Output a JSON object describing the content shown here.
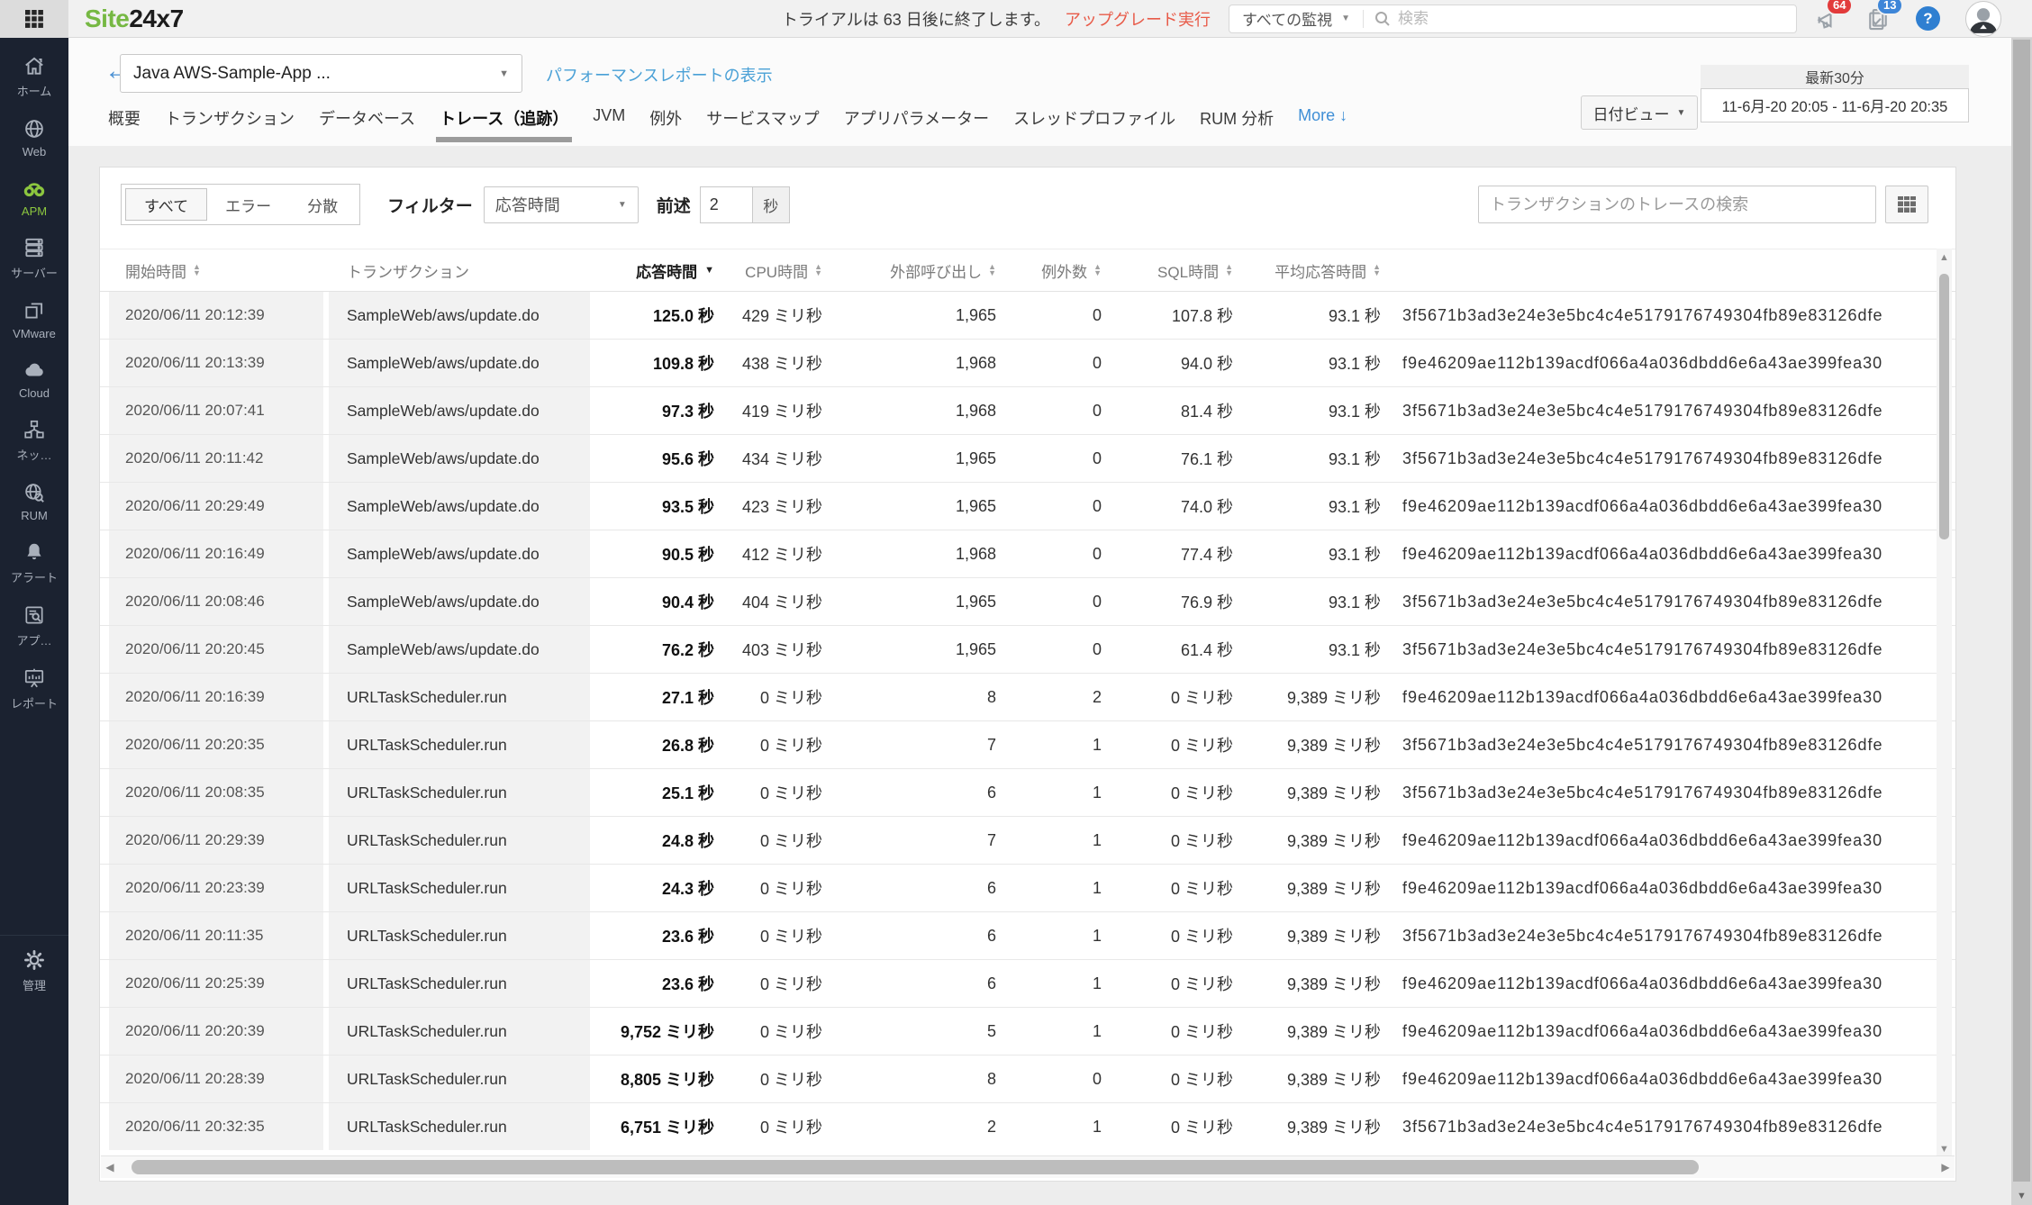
{
  "logo": {
    "part1": "Site",
    "part2": "24x7"
  },
  "topbar": {
    "trial_text": "トライアルは 63 日後に終了します。",
    "upgrade_label": "アップグレード実行",
    "monitor_filter_label": "すべての監視",
    "search_placeholder": "検索",
    "notifications_badge": "64",
    "tasks_badge": "13",
    "help_label": "?"
  },
  "sidebar": {
    "items": [
      {
        "label": "ホーム",
        "icon": "home"
      },
      {
        "label": "Web",
        "icon": "globe"
      },
      {
        "label": "APM",
        "icon": "binoculars",
        "active": true
      },
      {
        "label": "サーバー",
        "icon": "server"
      },
      {
        "label": "VMware",
        "icon": "vmware-squares"
      },
      {
        "label": "Cloud",
        "icon": "cloud"
      },
      {
        "label": "ネッ…",
        "icon": "network"
      },
      {
        "label": "RUM",
        "icon": "globe-magnifier"
      },
      {
        "label": "アラート",
        "icon": "bell"
      },
      {
        "label": "アプ…",
        "icon": "app-magnifier"
      },
      {
        "label": "レポート",
        "icon": "report-board"
      }
    ],
    "admin": {
      "label": "管理",
      "icon": "gear"
    }
  },
  "header": {
    "app_selector_value": "Java AWS-Sample-App ...",
    "performance_link_label": "パフォーマンスレポートの表示",
    "date_view_label": "日付ビュー",
    "time_range_label": "最新30分",
    "time_range_value": "11-6月-20 20:05 - 11-6月-20 20:35"
  },
  "tabs": {
    "items": [
      "概要",
      "トランザクション",
      "データベース",
      "トレース（追跡）",
      "JVM",
      "例外",
      "サービスマップ",
      "アプリパラメーター",
      "スレッドプロファイル",
      "RUM 分析",
      "More ↓"
    ],
    "active_index": 3
  },
  "filter_bar": {
    "view_options": [
      "すべて",
      "エラー",
      "分散"
    ],
    "selected_view_index": 0,
    "filter_label": "フィルター",
    "filter_field_value": "応答時間",
    "condition_label": "前述",
    "threshold_value": "2",
    "unit_label": "秒",
    "trace_search_placeholder": "トランザクションのトレースの検索"
  },
  "table": {
    "col_keys": [
      "start-time",
      "transaction",
      "response-time",
      "cpu-time",
      "external-calls",
      "exception-count",
      "sql-time",
      "avg-response-time",
      "trace-id"
    ],
    "columns": [
      {
        "label": "開始時間",
        "sort": "updown"
      },
      {
        "label": "トランザクション",
        "sort": "none"
      },
      {
        "label": "応答時間",
        "sort": "desc"
      },
      {
        "label": "CPU時間",
        "sort": "updown"
      },
      {
        "label": "外部呼び出し",
        "sort": "updown"
      },
      {
        "label": "例外数",
        "sort": "updown"
      },
      {
        "label": "SQL時間",
        "sort": "updown"
      },
      {
        "label": "平均応答時間",
        "sort": "updown"
      },
      {
        "label": "",
        "sort": "none"
      }
    ],
    "rows": [
      [
        "2020/06/11 20:12:39",
        "SampleWeb/aws/update.do",
        "125.0 秒",
        "429 ミリ秒",
        "1,965",
        "0",
        "107.8 秒",
        "93.1 秒",
        "3f5671b3ad3e24e3e5bc4c4e5179176749304fb89e83126dfe"
      ],
      [
        "2020/06/11 20:13:39",
        "SampleWeb/aws/update.do",
        "109.8 秒",
        "438 ミリ秒",
        "1,968",
        "0",
        "94.0 秒",
        "93.1 秒",
        "f9e46209ae112b139acdf066a4a036dbdd6e6a43ae399fea30"
      ],
      [
        "2020/06/11 20:07:41",
        "SampleWeb/aws/update.do",
        "97.3 秒",
        "419 ミリ秒",
        "1,968",
        "0",
        "81.4 秒",
        "93.1 秒",
        "3f5671b3ad3e24e3e5bc4c4e5179176749304fb89e83126dfe"
      ],
      [
        "2020/06/11 20:11:42",
        "SampleWeb/aws/update.do",
        "95.6 秒",
        "434 ミリ秒",
        "1,965",
        "0",
        "76.1 秒",
        "93.1 秒",
        "3f5671b3ad3e24e3e5bc4c4e5179176749304fb89e83126dfe"
      ],
      [
        "2020/06/11 20:29:49",
        "SampleWeb/aws/update.do",
        "93.5 秒",
        "423 ミリ秒",
        "1,965",
        "0",
        "74.0 秒",
        "93.1 秒",
        "f9e46209ae112b139acdf066a4a036dbdd6e6a43ae399fea30"
      ],
      [
        "2020/06/11 20:16:49",
        "SampleWeb/aws/update.do",
        "90.5 秒",
        "412 ミリ秒",
        "1,968",
        "0",
        "77.4 秒",
        "93.1 秒",
        "f9e46209ae112b139acdf066a4a036dbdd6e6a43ae399fea30"
      ],
      [
        "2020/06/11 20:08:46",
        "SampleWeb/aws/update.do",
        "90.4 秒",
        "404 ミリ秒",
        "1,965",
        "0",
        "76.9 秒",
        "93.1 秒",
        "3f5671b3ad3e24e3e5bc4c4e5179176749304fb89e83126dfe"
      ],
      [
        "2020/06/11 20:20:45",
        "SampleWeb/aws/update.do",
        "76.2 秒",
        "403 ミリ秒",
        "1,965",
        "0",
        "61.4 秒",
        "93.1 秒",
        "3f5671b3ad3e24e3e5bc4c4e5179176749304fb89e83126dfe"
      ],
      [
        "2020/06/11 20:16:39",
        "URLTaskScheduler.run",
        "27.1 秒",
        "0 ミリ秒",
        "8",
        "2",
        "0 ミリ秒",
        "9,389 ミリ秒",
        "f9e46209ae112b139acdf066a4a036dbdd6e6a43ae399fea30"
      ],
      [
        "2020/06/11 20:20:35",
        "URLTaskScheduler.run",
        "26.8 秒",
        "0 ミリ秒",
        "7",
        "1",
        "0 ミリ秒",
        "9,389 ミリ秒",
        "3f5671b3ad3e24e3e5bc4c4e5179176749304fb89e83126dfe"
      ],
      [
        "2020/06/11 20:08:35",
        "URLTaskScheduler.run",
        "25.1 秒",
        "0 ミリ秒",
        "6",
        "1",
        "0 ミリ秒",
        "9,389 ミリ秒",
        "3f5671b3ad3e24e3e5bc4c4e5179176749304fb89e83126dfe"
      ],
      [
        "2020/06/11 20:29:39",
        "URLTaskScheduler.run",
        "24.8 秒",
        "0 ミリ秒",
        "7",
        "1",
        "0 ミリ秒",
        "9,389 ミリ秒",
        "f9e46209ae112b139acdf066a4a036dbdd6e6a43ae399fea30"
      ],
      [
        "2020/06/11 20:23:39",
        "URLTaskScheduler.run",
        "24.3 秒",
        "0 ミリ秒",
        "6",
        "1",
        "0 ミリ秒",
        "9,389 ミリ秒",
        "f9e46209ae112b139acdf066a4a036dbdd6e6a43ae399fea30"
      ],
      [
        "2020/06/11 20:11:35",
        "URLTaskScheduler.run",
        "23.6 秒",
        "0 ミリ秒",
        "6",
        "1",
        "0 ミリ秒",
        "9,389 ミリ秒",
        "3f5671b3ad3e24e3e5bc4c4e5179176749304fb89e83126dfe"
      ],
      [
        "2020/06/11 20:25:39",
        "URLTaskScheduler.run",
        "23.6 秒",
        "0 ミリ秒",
        "6",
        "1",
        "0 ミリ秒",
        "9,389 ミリ秒",
        "f9e46209ae112b139acdf066a4a036dbdd6e6a43ae399fea30"
      ],
      [
        "2020/06/11 20:20:39",
        "URLTaskScheduler.run",
        "9,752 ミリ秒",
        "0 ミリ秒",
        "5",
        "1",
        "0 ミリ秒",
        "9,389 ミリ秒",
        "f9e46209ae112b139acdf066a4a036dbdd6e6a43ae399fea30"
      ],
      [
        "2020/06/11 20:28:39",
        "URLTaskScheduler.run",
        "8,805 ミリ秒",
        "0 ミリ秒",
        "8",
        "0",
        "0 ミリ秒",
        "9,389 ミリ秒",
        "f9e46209ae112b139acdf066a4a036dbdd6e6a43ae399fea30"
      ],
      [
        "2020/06/11 20:32:35",
        "URLTaskScheduler.run",
        "6,751 ミリ秒",
        "0 ミリ秒",
        "2",
        "1",
        "0 ミリ秒",
        "9,389 ミリ秒",
        "3f5671b3ad3e24e3e5bc4c4e5179176749304fb89e83126dfe"
      ]
    ]
  },
  "colors": {
    "brand_green": "#76b843",
    "apm_active_green": "#8cc63f",
    "sidebar_bg": "#1b2230",
    "upgrade_red": "#e85a48",
    "badge_red": "#e23b3b",
    "badge_blue": "#3e86d8",
    "link_blue": "#49a0d6",
    "frozen_column_bg": "#f2f2f2"
  }
}
